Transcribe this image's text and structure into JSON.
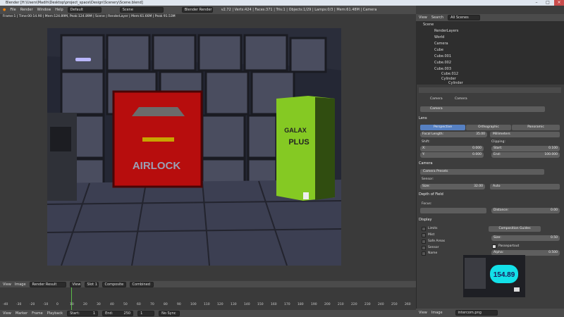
{
  "window": {
    "title": "Blender [H:\\Users\\Madih\\Desktop\\project_space\\Design\\Scenery\\Scene.blend]"
  },
  "menu": {
    "items": [
      "File",
      "Render",
      "Window",
      "Help"
    ],
    "layout": "Default",
    "scene": "Scene",
    "engine": "Blender Render",
    "stats": "v2.72 | Verts:424 | Faces:371 | Tris:1 | Objects:1/29 | Lamps:0/3 | Mem:61.48M | Camera"
  },
  "render": {
    "info": "Frame:1 | Time:00:14.90 | Mem:124.89M, Peak:124.89M | Scene | RenderLayer | Mem:61.66M | Peak 91.53M"
  },
  "scene": {
    "airlock": "AIRLOCK",
    "galax": "GALAX",
    "plus": "PLUS"
  },
  "image_header": {
    "view": "View",
    "image": "Image",
    "name": "Render Result",
    "slot_view": "View",
    "slot": "Slot 1",
    "composite": "Composite",
    "combined": "Combined"
  },
  "timeline": {
    "ticks": [
      "-40",
      "-30",
      "-20",
      "-10",
      "0",
      "10",
      "20",
      "30",
      "40",
      "50",
      "60",
      "70",
      "80",
      "90",
      "100",
      "110",
      "120",
      "130",
      "140",
      "150",
      "160",
      "170",
      "180",
      "190",
      "200",
      "210",
      "220",
      "230",
      "240",
      "250",
      "260"
    ]
  },
  "bottom": {
    "view": "View",
    "marker": "Marker",
    "frame": "Frame",
    "playback": "Playback",
    "start": "Start:",
    "start_val": "1",
    "end": "End:",
    "end_val": "250",
    "current": "1",
    "sync": "No Sync"
  },
  "outliner": {
    "view": "View",
    "search": "Search",
    "filter": "All Scenes",
    "rows": [
      "Scene",
      "RenderLayers",
      "World",
      "Camera",
      "Cube",
      "Cube.001",
      "Cube.002",
      "Cube.003",
      "Cube.012",
      "Cylinder",
      "Cylinder"
    ]
  },
  "props": {
    "camera_path": "Camera",
    "camera_name": "Camera",
    "lens": "Lens",
    "persp": "Perspective",
    "ortho": "Orthographic",
    "pano": "Panoramic",
    "focal_length": "Focal Length:",
    "focal_val": "35.00",
    "millimeters": "Millimeters",
    "shift": "Shift:",
    "clipping": "Clipping:",
    "x": "X:",
    "x_val": "0.000",
    "y": "Y:",
    "y_val": "0.000",
    "start": "Start:",
    "start_val": "0.100",
    "end": "End:",
    "end_val": "100.000",
    "camera": "Camera",
    "presets": "Camera Presets",
    "sensor": "Sensor:",
    "size": "Size:",
    "size_val": "32.00",
    "auto": "Auto",
    "dof": "Depth of Field",
    "focus": "Focus:",
    "distance": "Distance:",
    "distance_val": "0.00",
    "display": "Display",
    "limits": "Limits",
    "mist": "Mist",
    "safe_areas": "Safe Areas",
    "sensor_chk": "Sensor",
    "name_chk": "Name",
    "comp_guides": "Composition Guides",
    "size2": "Size:",
    "size2_val": "0.50",
    "passepartout": "Passepartout",
    "alpha": "Alpha:",
    "alpha_val": "0.500"
  },
  "thumb": {
    "readout": "154.89",
    "view": "View",
    "image": "Image",
    "file": "intercom.png"
  }
}
